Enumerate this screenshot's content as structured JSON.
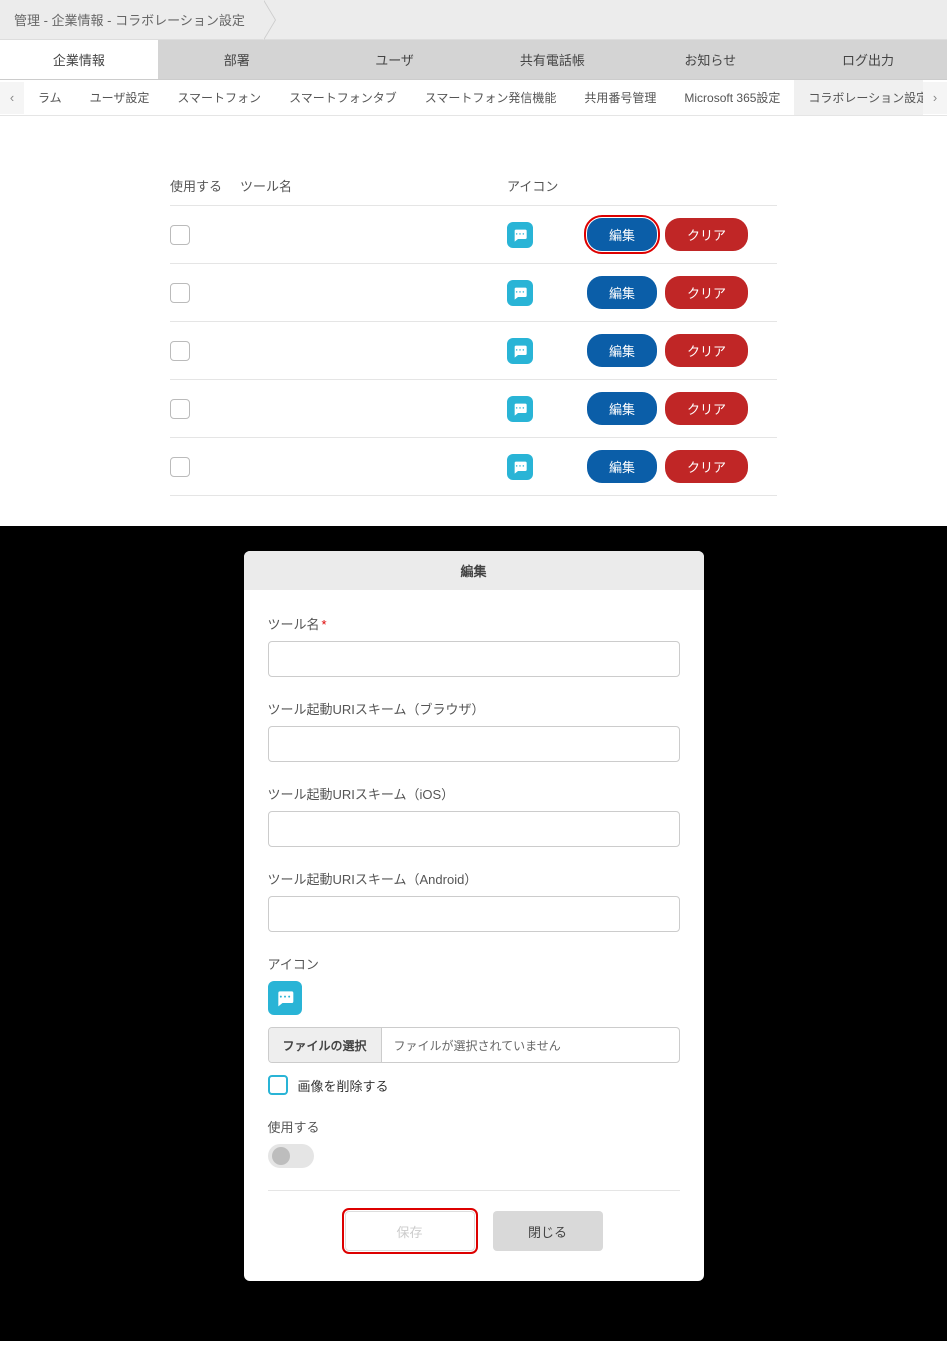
{
  "breadcrumb": "管理 - 企業情報 - コラボレーション設定",
  "primaryTabs": [
    "企業情報",
    "部署",
    "ユーザ",
    "共有電話帳",
    "お知らせ",
    "ログ出力"
  ],
  "activePrimary": 0,
  "subTabs": [
    "ラム",
    "ユーザ設定",
    "スマートフォン",
    "スマートフォンタブ",
    "スマートフォン発信機能",
    "共用番号管理",
    "Microsoft 365設定",
    "コラボレーション設定"
  ],
  "activeSub": 7,
  "table": {
    "headers": {
      "use": "使用する",
      "tool": "ツール名",
      "icon": "アイコン"
    },
    "editLabel": "編集",
    "clearLabel": "クリア",
    "rows": [
      {
        "highlight": true
      },
      {
        "highlight": false
      },
      {
        "highlight": false
      },
      {
        "highlight": false
      },
      {
        "highlight": false
      }
    ]
  },
  "modal": {
    "title": "編集",
    "fields": {
      "toolName": "ツール名",
      "uriBrowser": "ツール起動URIスキーム（ブラウザ）",
      "uriIos": "ツール起動URIスキーム（iOS）",
      "uriAndroid": "ツール起動URIスキーム（Android）",
      "iconLabel": "アイコン",
      "fileSelect": "ファイルの選択",
      "fileNone": "ファイルが選択されていません",
      "deleteImage": "画像を削除する",
      "useLabel": "使用する"
    },
    "save": "保存",
    "close": "閉じる"
  }
}
